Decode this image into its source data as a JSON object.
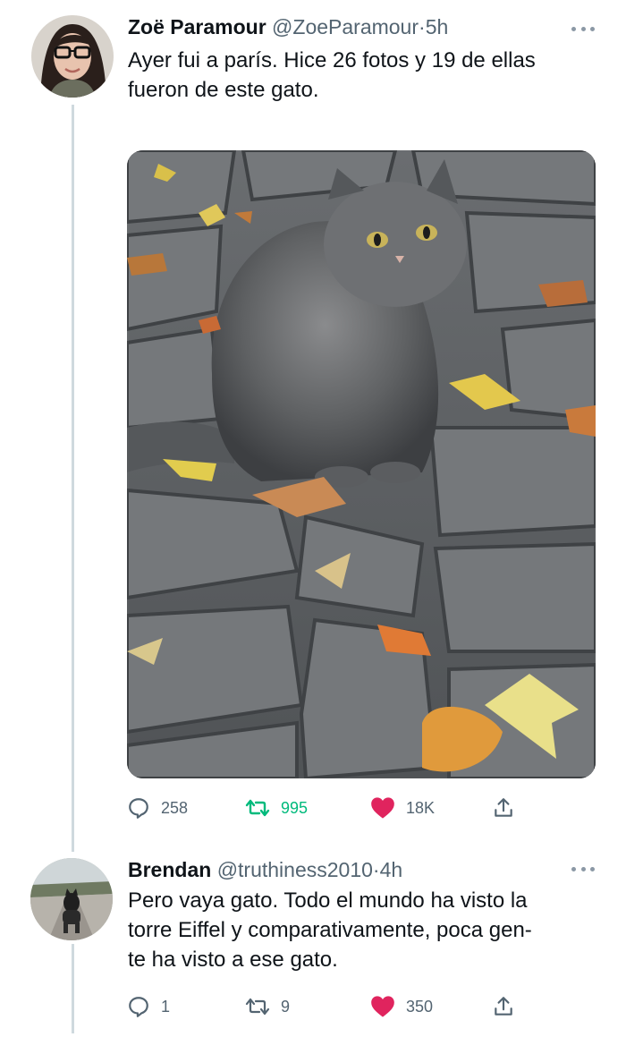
{
  "tweets": [
    {
      "author": {
        "name": "Zoë Paramour",
        "handle": "@ZoeParamour",
        "separator": "·",
        "time": "5h"
      },
      "text_lines": [
        "Ayer fui a parís. Hice 26 fotos y 19 de ellas",
        "fueron de este gato."
      ],
      "media": {
        "subject": "fluffy grey cat on cobblestones with autumn leaves"
      },
      "actions": {
        "replies": "258",
        "retweets": "995",
        "likes": "18K"
      },
      "retweet_color": "#00ba7c",
      "like_color": "#e0245e"
    },
    {
      "author": {
        "name": "Brendan",
        "handle": "@truthiness2010",
        "separator": "·",
        "time": "4h"
      },
      "text_lines": [
        "Pero vaya gato. Todo el mundo ha visto la",
        "torre Eiffel y comparativamente, poca gen-",
        "te ha visto a ese gato."
      ],
      "actions": {
        "replies": "1",
        "retweets": "9",
        "likes": "350"
      },
      "retweet_color": "#536471",
      "like_color": "#e0245e"
    }
  ]
}
